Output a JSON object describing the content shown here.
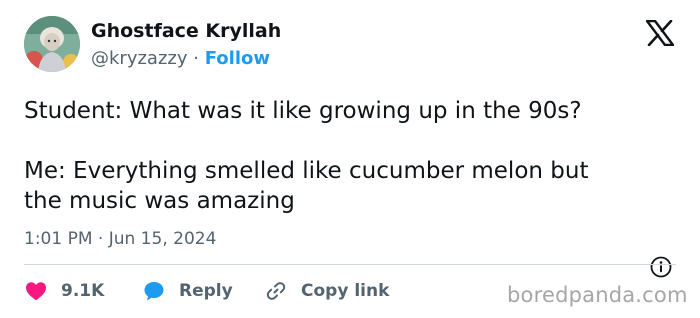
{
  "author": {
    "display_name": "Ghostface Kryllah",
    "handle": "@kryzazzy",
    "separator": "·",
    "follow_label": "Follow"
  },
  "post": {
    "line1": "Student: What was it like growing up in the 90s?",
    "line2": "Me: Everything smelled like cucumber melon but",
    "line3": "the music was amazing",
    "time": "1:01 PM",
    "date_separator": "·",
    "date": "Jun 15, 2024"
  },
  "actions": {
    "like_count": "9.1K",
    "reply_label": "Reply",
    "copy_label": "Copy link"
  },
  "icons": {
    "brand": "x-logo-icon",
    "info": "info-icon",
    "like": "heart-icon",
    "reply": "speech-bubble-icon",
    "copy": "link-icon"
  },
  "colors": {
    "text": "#0f1419",
    "secondary": "#536471",
    "link": "#1d9bf0",
    "heart": "#f91880",
    "divider": "#cfd9de"
  },
  "watermark": "boredpanda.com"
}
